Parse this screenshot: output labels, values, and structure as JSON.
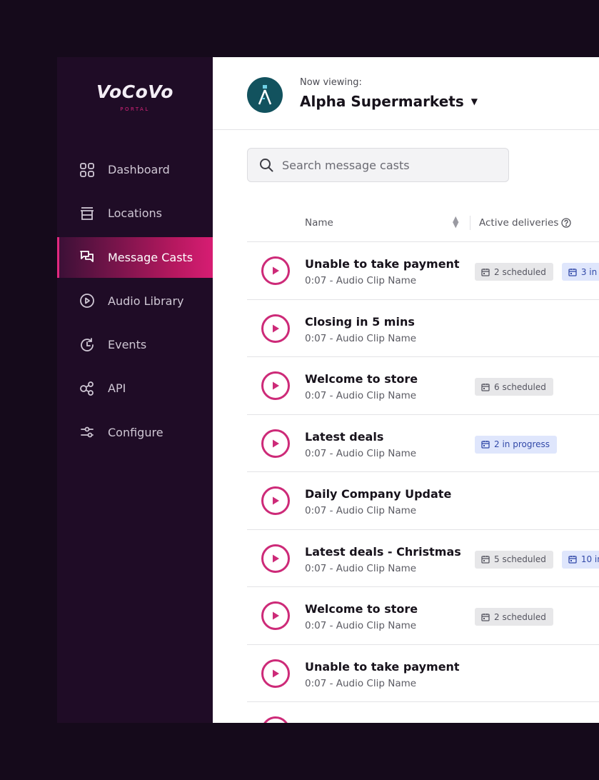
{
  "brand": {
    "logo_text": "VoCoVo",
    "logo_sub": "PORTAL"
  },
  "sidebar": {
    "items": [
      {
        "label": "Dashboard",
        "icon": "grid-icon"
      },
      {
        "label": "Locations",
        "icon": "store-icon"
      },
      {
        "label": "Message Casts",
        "icon": "chat-bubbles-icon",
        "active": true
      },
      {
        "label": "Audio Library",
        "icon": "play-circle-icon"
      },
      {
        "label": "Events",
        "icon": "clock-history-icon"
      },
      {
        "label": "API",
        "icon": "api-nodes-icon"
      },
      {
        "label": "Configure",
        "icon": "sliders-icon"
      }
    ]
  },
  "header": {
    "now_viewing": "Now viewing:",
    "org_name": "Alpha Supermarkets",
    "org_logo_letter": "A"
  },
  "search": {
    "placeholder": "Search message casts"
  },
  "table": {
    "columns": {
      "name": "Name",
      "active": "Active deliveries"
    },
    "rows": [
      {
        "title": "Unable to take payment",
        "subtitle": "0:07 - Audio Clip Name",
        "scheduled": "2 scheduled",
        "progress": "3 in"
      },
      {
        "title": "Closing in 5 mins",
        "subtitle": "0:07 - Audio Clip Name"
      },
      {
        "title": "Welcome to store",
        "subtitle": "0:07 - Audio Clip Name",
        "scheduled": "6 scheduled"
      },
      {
        "title": "Latest deals",
        "subtitle": "0:07 - Audio Clip Name",
        "progress": "2 in progress"
      },
      {
        "title": "Daily Company Update",
        "subtitle": "0:07 - Audio Clip Name"
      },
      {
        "title": "Latest deals - Christmas",
        "subtitle": "0:07 - Audio Clip Name",
        "scheduled": "5 scheduled",
        "progress": "10 in"
      },
      {
        "title": "Welcome to store",
        "subtitle": "0:07 - Audio Clip Name",
        "scheduled": "2 scheduled"
      },
      {
        "title": "Unable to take payment",
        "subtitle": "0:07 - Audio Clip Name"
      }
    ]
  },
  "colors": {
    "accent": "#d71d73",
    "sidebar_bg": "#1f0c26",
    "page_bg": "#150a1b",
    "org_logo_bg": "#12525e",
    "progress_bg": "#dfe6fc",
    "progress_text": "#3249a8"
  }
}
